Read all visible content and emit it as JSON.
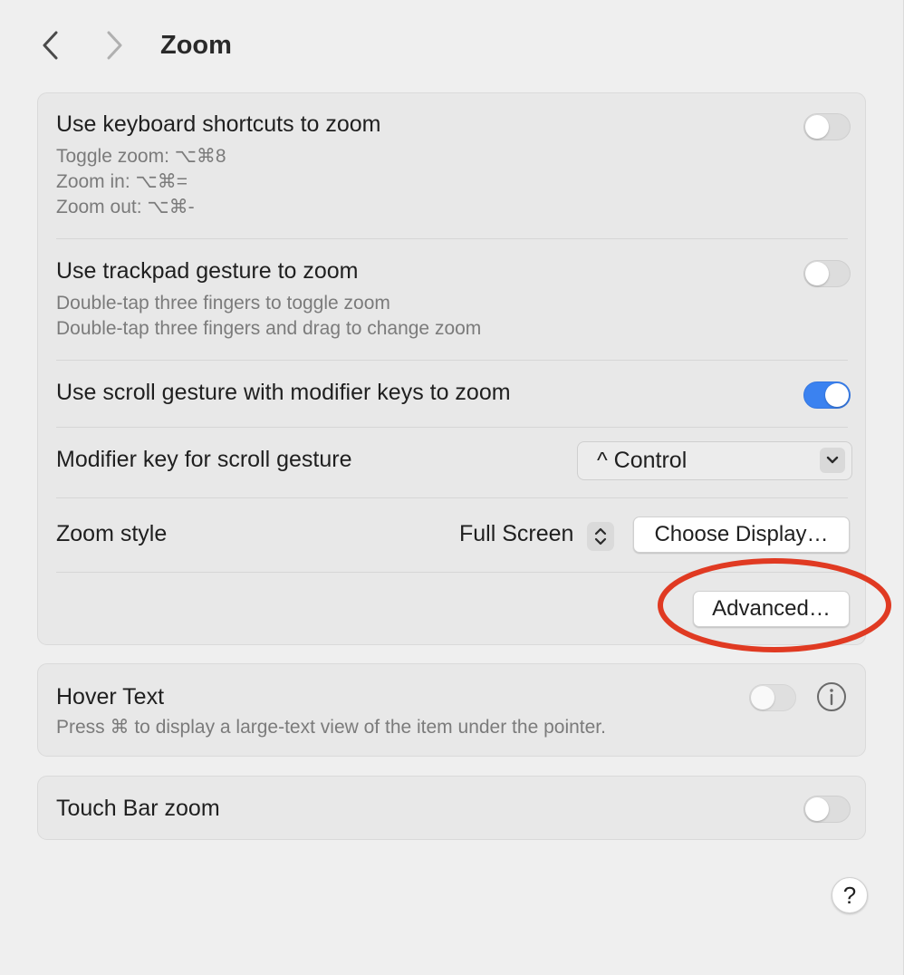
{
  "header": {
    "title": "Zoom",
    "back_icon": "chevron-left-icon",
    "forward_icon": "chevron-right-icon"
  },
  "zoom_panel": {
    "keyboard": {
      "title": "Use keyboard shortcuts to zoom",
      "lines": [
        "Toggle zoom: ⌥⌘8",
        "Zoom in: ⌥⌘=",
        "Zoom out: ⌥⌘-"
      ],
      "enabled": false
    },
    "trackpad": {
      "title": "Use trackpad gesture to zoom",
      "lines": [
        "Double-tap three fingers to toggle zoom",
        "Double-tap three fingers and drag to change zoom"
      ],
      "enabled": false
    },
    "scroll": {
      "title": "Use scroll gesture with modifier keys to zoom",
      "enabled": true
    },
    "modifier": {
      "title": "Modifier key for scroll gesture",
      "value": "^ Control"
    },
    "zoom_style": {
      "title": "Zoom style",
      "value": "Full Screen",
      "choose_display_label": "Choose Display…"
    },
    "advanced_label": "Advanced…"
  },
  "hover_panel": {
    "title": "Hover Text",
    "description": "Press ⌘ to display a large-text view of the item under the pointer.",
    "enabled": false
  },
  "touchbar_panel": {
    "title": "Touch Bar zoom",
    "enabled": false
  },
  "help_label": "?",
  "colors": {
    "accent": "#3b82f0",
    "annotation": "#e03a22",
    "background": "#efefef"
  }
}
